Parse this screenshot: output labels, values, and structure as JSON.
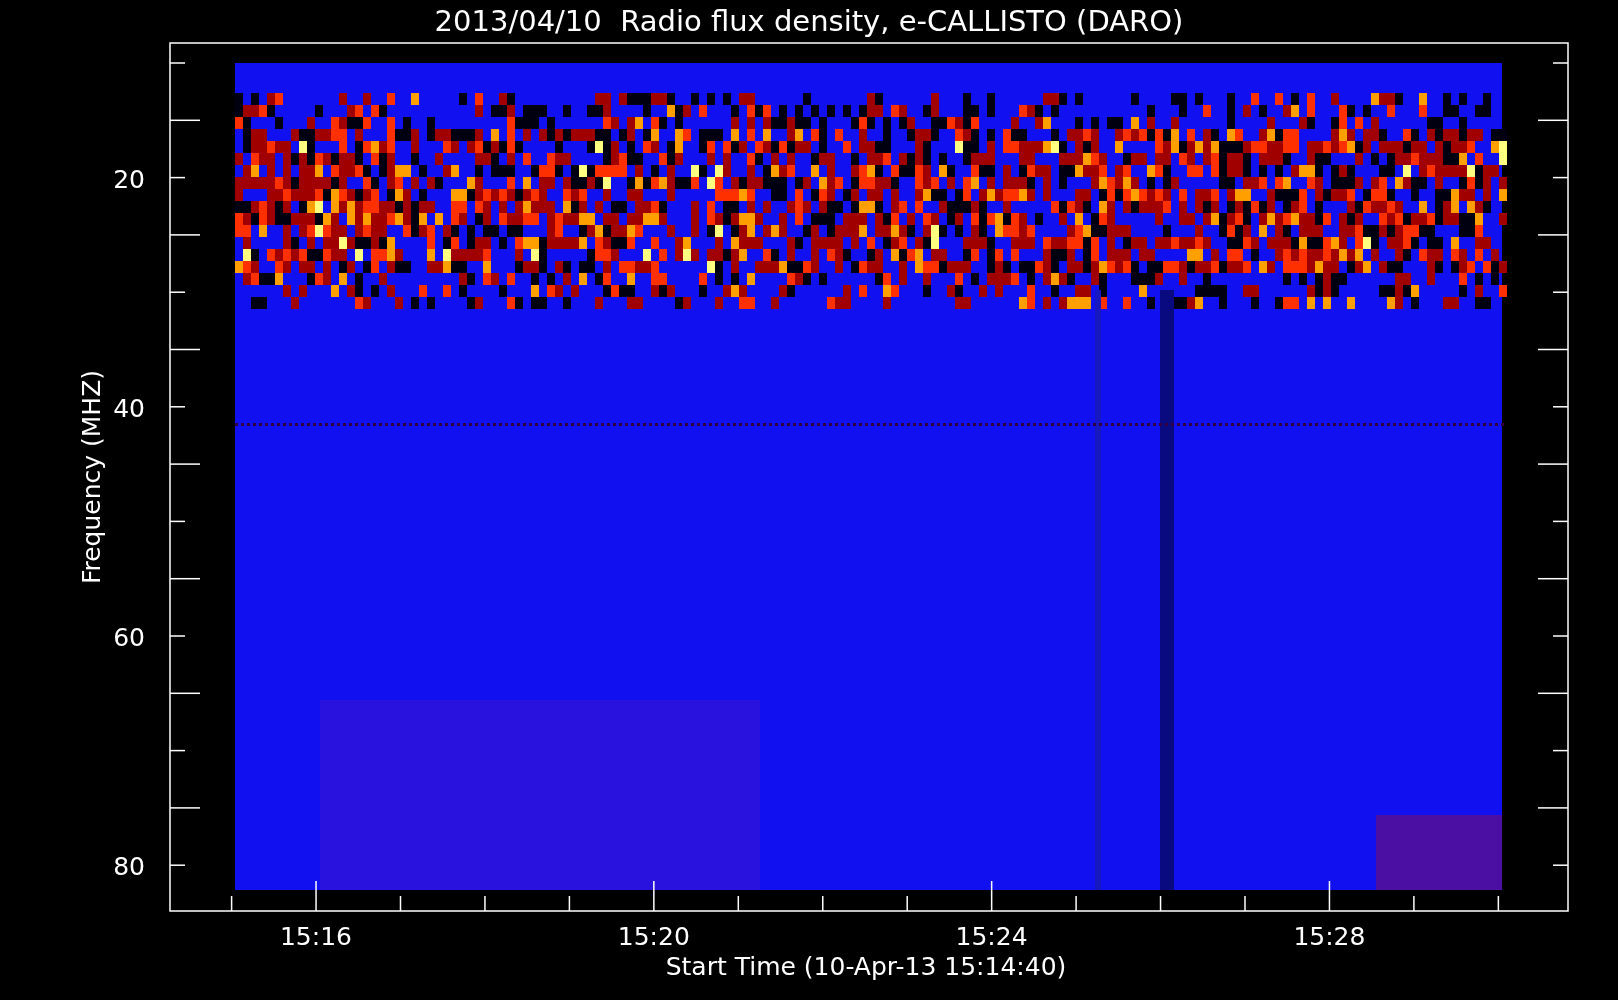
{
  "title": "2013/04/10  Radio flux density, e-CALLISTO (DARO)",
  "ylabel": "Frequency (MHZ)",
  "xlabel": "Start Time (10-Apr-13 15:14:40)",
  "yticks": [
    "20",
    "40",
    "60",
    "80"
  ],
  "xticks": [
    "15:16",
    "15:20",
    "15:24",
    "15:28"
  ]
}
